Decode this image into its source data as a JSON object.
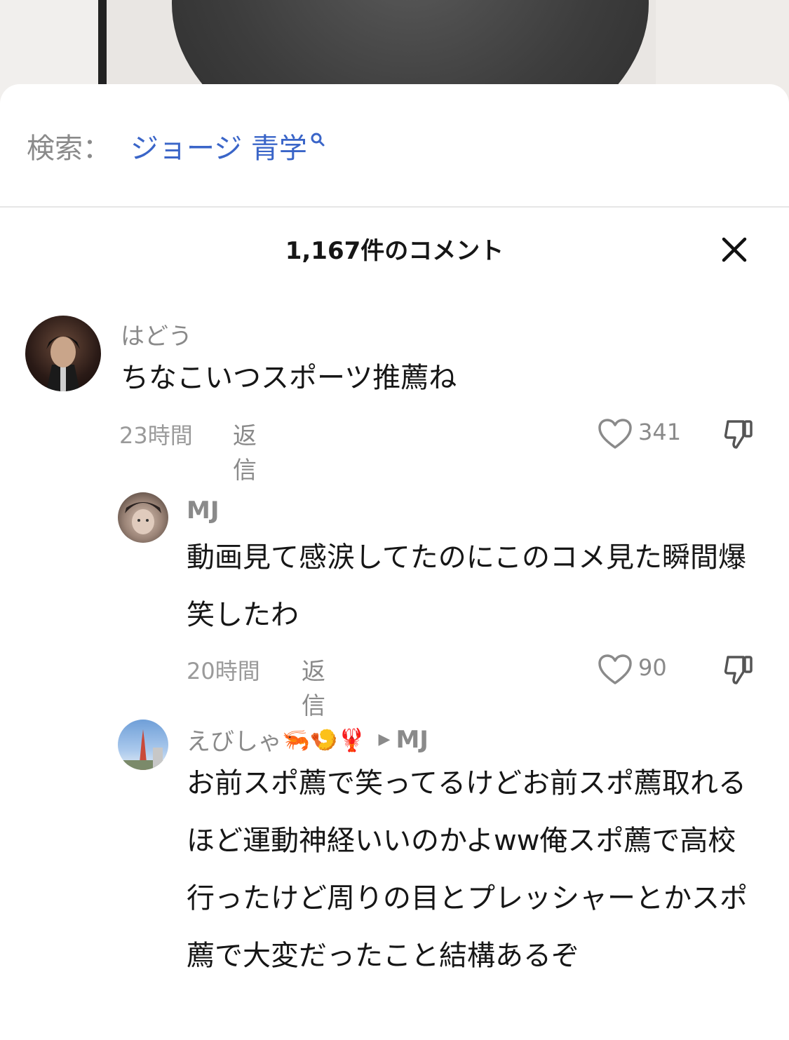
{
  "search": {
    "prefix": "検索：",
    "term": "ジョージ 青学"
  },
  "comments_header": {
    "title": "1,167件のコメント"
  },
  "comments": [
    {
      "username": "はどう",
      "text": "ちなこいつスポーツ推薦ね",
      "time": "23時間",
      "reply_label": "返信",
      "likes": "341"
    },
    {
      "username": "MJ",
      "text": "動画見て感涙してたのにこのコメ見た瞬間爆笑したわ",
      "time": "20時間",
      "reply_label": "返信",
      "likes": "90"
    },
    {
      "username": "えびしゃ",
      "username_emoji": "🦐🍤🦞",
      "reply_to": "MJ",
      "text": "お前スポ薦で笑ってるけどお前スポ薦取れるほど運動神経いいのかよww俺スポ薦で高校行ったけど周りの目とプレッシャーとかスポ薦で大変だったこと結構あるぞ"
    }
  ],
  "colors": {
    "accent": "#3a65c8",
    "muted": "#8a8a8a",
    "text": "#161616"
  }
}
